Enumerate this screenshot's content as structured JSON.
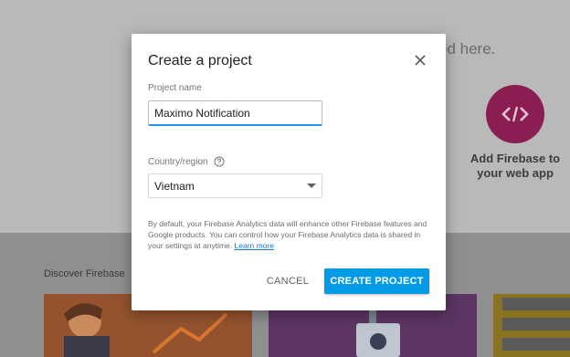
{
  "background": {
    "partial_text": "ed here.",
    "web_card": {
      "icon": "code-brackets-icon",
      "label": "Add Firebase to your web app",
      "color": "#8a1e52"
    },
    "discover_title": "Discover Firebase"
  },
  "dialog": {
    "title": "Create a project",
    "close_icon": "close-icon",
    "project_name": {
      "label": "Project name",
      "value": "Maximo Notification"
    },
    "country": {
      "label": "Country/region",
      "help_icon": "help-circle-icon",
      "value": "Vietnam"
    },
    "disclaimer": "By default, your Firebase Analytics data will enhance other Firebase features and Google products. You can control how your Firebase Analytics data is shared in your settings at anytime.",
    "learn_more": "Learn more",
    "cancel_label": "CANCEL",
    "create_label": "CREATE PROJECT",
    "accent_color": "#039be5"
  }
}
